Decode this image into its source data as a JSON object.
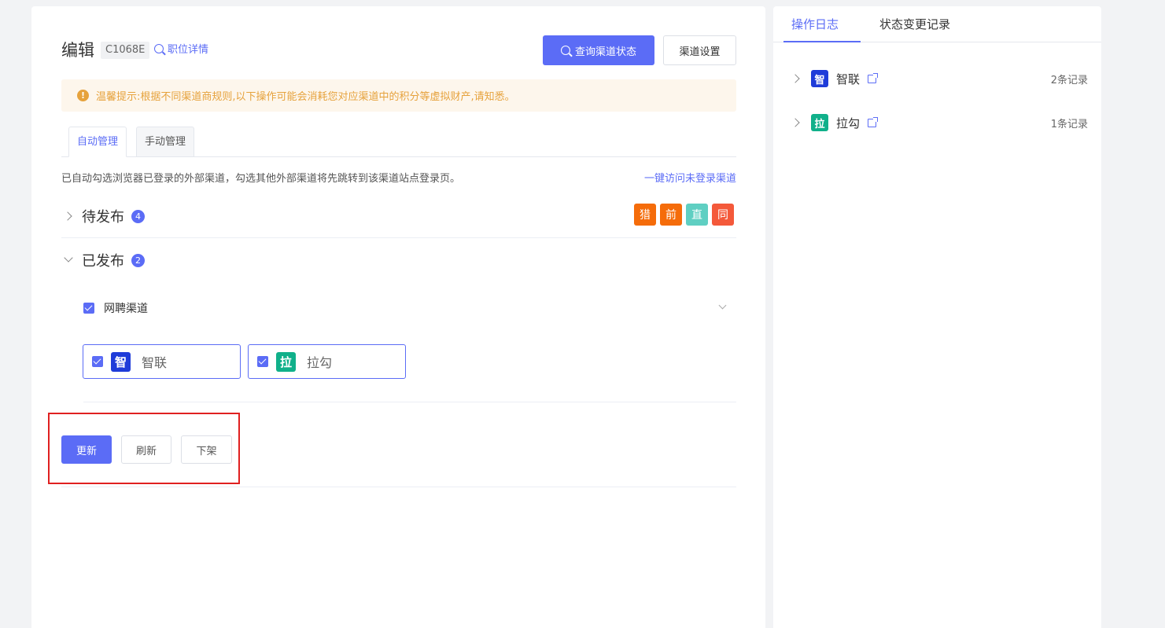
{
  "header": {
    "title": "编辑",
    "job_code": "C1068E",
    "job_detail_link": "职位详情",
    "query_status_button": "查询渠道状态",
    "channel_settings_button": "渠道设置"
  },
  "notice": {
    "icon": "!",
    "text": "温馨提示:根据不同渠道商规则,以下操作可能会消耗您对应渠道中的积分等虚拟财产,请知悉。"
  },
  "tabs": [
    {
      "label": "自动管理",
      "active": true
    },
    {
      "label": "手动管理",
      "active": false
    }
  ],
  "auto": {
    "description": "已自动勾选浏览器已登录的外部渠道，勾选其他外部渠道将先跳转到该渠道站点登录页。",
    "visit_link": "一键访问未登录渠道"
  },
  "pending": {
    "title": "待发布",
    "count": "4",
    "channel_badges": [
      {
        "label": "猎",
        "color": "#f56c0a"
      },
      {
        "label": "前",
        "color": "#f56c0a"
      },
      {
        "label": "直",
        "color": "#5fcfc2"
      },
      {
        "label": "同",
        "color": "#f4593a"
      }
    ]
  },
  "published": {
    "title": "已发布",
    "count": "2",
    "group_label": "网聘渠道",
    "channels": [
      {
        "logo": "智",
        "name": "智联",
        "color": "#1f3cd9",
        "checked": true
      },
      {
        "logo": "拉",
        "name": "拉勾",
        "color": "#10b08a",
        "checked": true
      }
    ]
  },
  "actions": {
    "update": "更新",
    "refresh": "刷新",
    "offline": "下架"
  },
  "side": {
    "tabs": [
      {
        "label": "操作日志",
        "active": true
      },
      {
        "label": "状态变更记录",
        "active": false
      }
    ],
    "logs": [
      {
        "logo": "智",
        "name": "智联",
        "color": "#1f3cd9",
        "count": "2条记录"
      },
      {
        "logo": "拉",
        "name": "拉勾",
        "color": "#10b08a",
        "count": "1条记录"
      }
    ]
  },
  "colors": {
    "accent": "#5b6cf6",
    "warning": "#e6a23c",
    "highlight": "#e02020"
  }
}
